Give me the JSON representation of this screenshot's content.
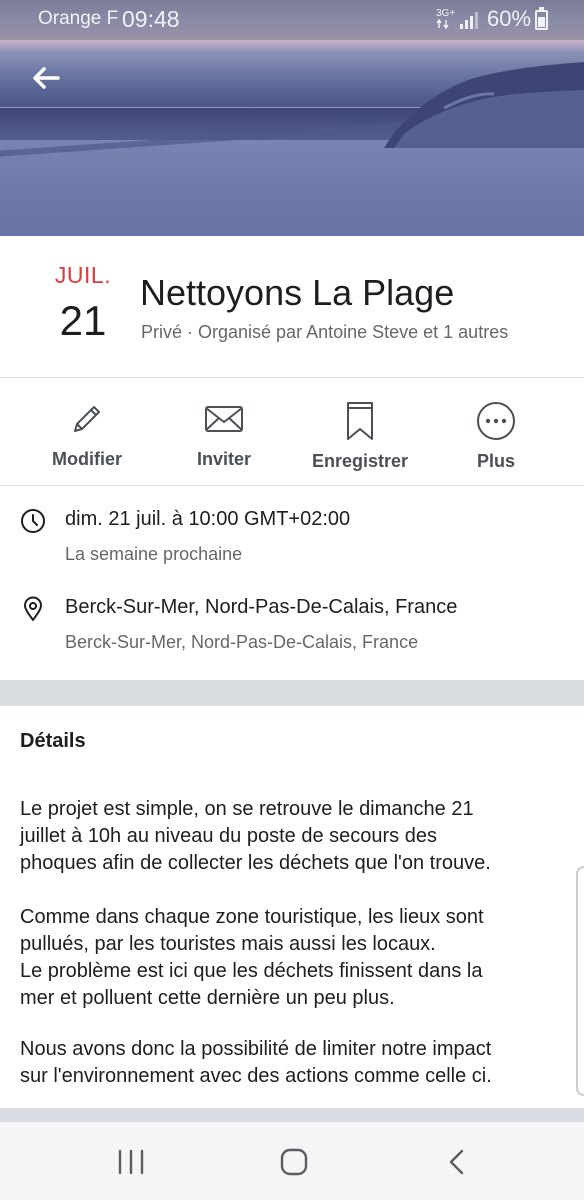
{
  "status_bar": {
    "carrier": "Orange F",
    "time": "09:48",
    "network": "3G+",
    "battery": "60%"
  },
  "event": {
    "month": "JUIL.",
    "day": "21",
    "title": "Nettoyons La Plage",
    "meta": "Privé · Organisé par Antoine Steve et 1 autres"
  },
  "actions": [
    {
      "label": "Modifier",
      "icon": "pencil-icon"
    },
    {
      "label": "Inviter",
      "icon": "envelope-icon"
    },
    {
      "label": "Enregistrer",
      "icon": "bookmark-icon"
    },
    {
      "label": "Plus",
      "icon": "more-icon"
    }
  ],
  "info": {
    "datetime": "dim. 21 juil. à 10:00 GMT+02:00",
    "relative": "La semaine prochaine",
    "location": "Berck-Sur-Mer, Nord-Pas-De-Calais, France",
    "location_sub": "Berck-Sur-Mer, Nord-Pas-De-Calais, France"
  },
  "details": {
    "heading": "Détails",
    "paragraphs": [
      "Le projet est simple, on se retrouve le dimanche 21\njuillet à 10h au niveau du poste de secours des\nphoques afin de collecter les déchets que l'on trouve.",
      "Comme dans chaque zone touristique, les lieux sont\npullués, par les touristes mais aussi les locaux.\nLe problème est ici que les déchets finissent dans la\nmer et polluent cette dernière un peu plus.",
      "Nous avons donc la possibilité de limiter notre impact\nsur l'environnement avec des actions comme celle ci."
    ]
  },
  "colors": {
    "accent_red": "#e0393e",
    "text_primary": "#1c1e21",
    "text_secondary": "#65676b",
    "divider": "#dadde1"
  }
}
